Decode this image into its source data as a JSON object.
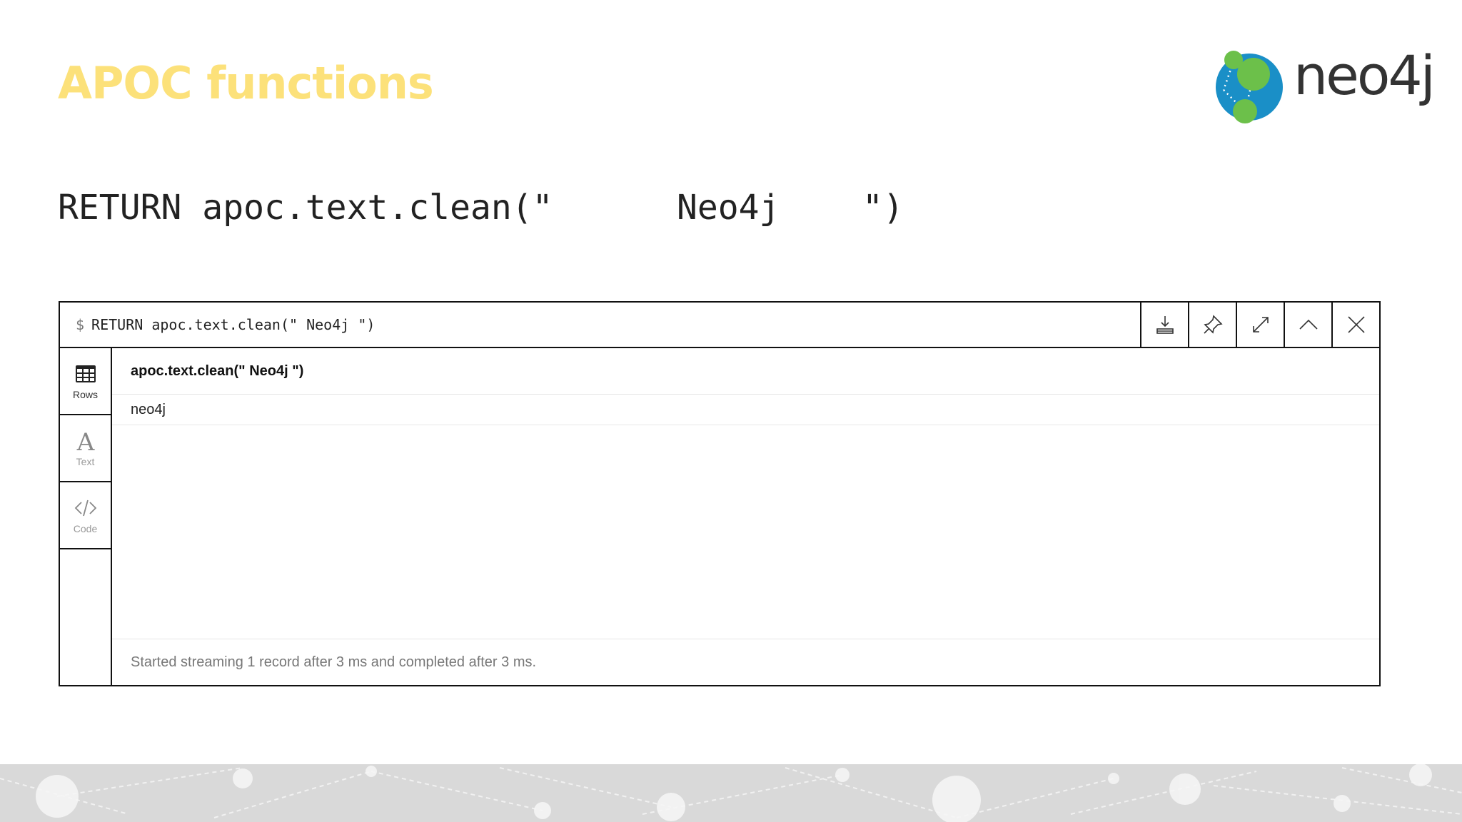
{
  "slide": {
    "title": "APOC functions"
  },
  "logo": {
    "text": "neo4j",
    "colors": {
      "blue": "#1a8fc7",
      "green": "#6cc04a"
    }
  },
  "code": {
    "line": "RETURN apoc.text.clean(\"      Neo4j    \")"
  },
  "frame": {
    "prompt": "$",
    "query": "RETURN apoc.text.clean(\" Neo4j \")",
    "actions": [
      "download-icon",
      "pin-icon",
      "expand-icon",
      "collapse-up-icon",
      "close-icon"
    ]
  },
  "sidebar": {
    "items": [
      {
        "label": "Rows",
        "icon": "table-icon",
        "active": true
      },
      {
        "label": "Text",
        "icon": "text-icon",
        "active": false
      },
      {
        "label": "Code",
        "icon": "code-icon",
        "active": false
      }
    ]
  },
  "result": {
    "columns": [
      "apoc.text.clean(\" Neo4j \")"
    ],
    "rows": [
      [
        "neo4j"
      ]
    ],
    "status": "Started streaming 1 record after 3 ms and completed after 3 ms."
  },
  "theme": {
    "title_color": "#fce17a",
    "footer_color": "#d9d9d9"
  }
}
